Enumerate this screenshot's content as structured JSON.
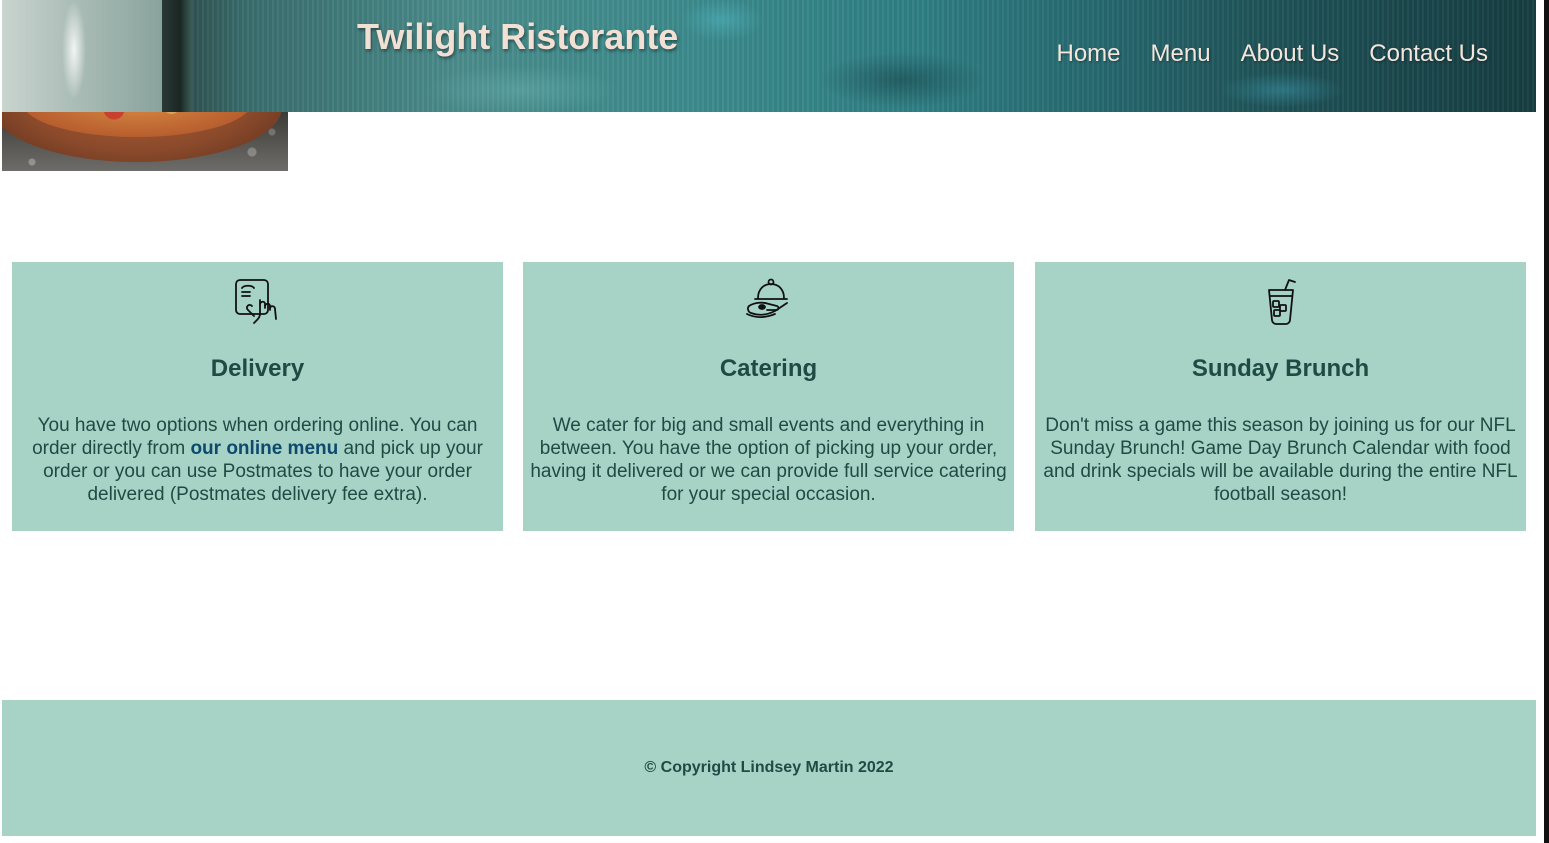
{
  "header": {
    "site_title": "Twilight Ristorante",
    "nav": [
      {
        "label": "Home"
      },
      {
        "label": "Menu"
      },
      {
        "label": "About Us"
      },
      {
        "label": "Contact Us"
      }
    ]
  },
  "hero": {
    "image_icon": "pizza-photo"
  },
  "cards": [
    {
      "icon": "tablet-tap-icon",
      "title": "Delivery",
      "text_before": "You have two options when ordering online. You can order directly from ",
      "link_text": "our online menu",
      "text_after": " and pick up your order or you can use Postmates to have your order delivered (Postmates delivery fee extra)."
    },
    {
      "icon": "serving-cloche-icon",
      "title": "Catering",
      "text": "We cater for big and small events and everything in between. You have the option of picking up your order, having it delivered or we can provide full service catering for your special occasion."
    },
    {
      "icon": "iced-drink-icon",
      "title": "Sunday Brunch",
      "text": "Don't miss a game this season by joining us for our NFL Sunday Brunch! Game Day Brunch Calendar with food and drink specials will be available during the entire NFL football season!"
    }
  ],
  "footer": {
    "copyright": "© Copyright Lindsey Martin 2022"
  },
  "colors": {
    "card_bg": "#a6d3c6",
    "heading": "#1e4b44",
    "link": "#0d4a6e",
    "title": "#f3e0d4"
  }
}
